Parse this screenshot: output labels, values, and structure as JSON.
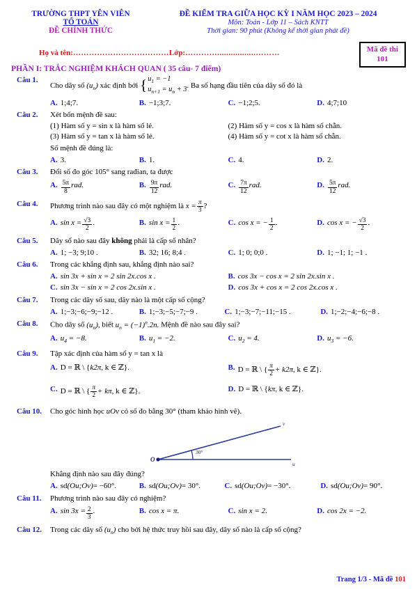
{
  "header": {
    "school": "TRƯỜNG THPT YÊN VIÊN",
    "department": "TỔ TOÁN",
    "official": "ĐỀ CHÍNH THỨC",
    "exam_title": "ĐỀ KIỂM TRA GIỮA HỌC KỲ I NĂM HỌC 2023 – 2024",
    "subject_line": "Môn: Toán - Lớp 11 – Sách KNTT",
    "time_line": "Thời gian: 90 phút (Không kể thời gian phát đề)",
    "code_label": "Mã đề thi",
    "code_value": "101",
    "name_label": "Họ và tên:",
    "name_dots": "………………………………",
    "class_label": "Lớp:",
    "class_dots": "………….................………"
  },
  "part_heading": "PHẦN I: TRẮC NGHIỆM KHÁCH QUAN ( 35 câu- 7 điểm)",
  "questions": {
    "q1": {
      "label": "Câu 1.",
      "stem_a": "Cho dãy số",
      "stem_b": "xác định bởi",
      "stem_c": ". Ba số hạng đầu tiên của dãy số đó là",
      "seq_symbol": "(u",
      "seq_sub": "n",
      "seq_close": ")",
      "sys_line1_left": "u",
      "sys_line1_sub": "1",
      "sys_line1_right": "= −1",
      "sys_line2_left": "u",
      "sys_line2_sub": "n+1",
      "sys_line2_right": "= u",
      "sys_line2_sub2": "n",
      "sys_line2_end": "+ 3",
      "answers": [
        {
          "letter": "A.",
          "text": "1;4;7."
        },
        {
          "letter": "B.",
          "text": "−1;3;7."
        },
        {
          "letter": "C.",
          "text": "−1;2;5."
        },
        {
          "letter": "D.",
          "text": "4;7;10"
        }
      ]
    },
    "q2": {
      "label": "Câu 2.",
      "stem": "Xét bốn mệnh đề sau:",
      "statements": [
        "(1) Hàm số  y = sin x  là hàm số lẻ.",
        "(2) Hàm số  y = cos x  là hàm số chẵn.",
        "(3) Hàm số  y = tan x  là hàm số lẻ.",
        "(4) Hàm số  y = cot x  là hàm số chẵn."
      ],
      "prompt": "Số mệnh đề đúng là:",
      "answers": [
        {
          "letter": "A.",
          "text": "3."
        },
        {
          "letter": "B.",
          "text": "1."
        },
        {
          "letter": "C.",
          "text": "4."
        },
        {
          "letter": "D.",
          "text": "2."
        }
      ]
    },
    "q3": {
      "label": "Câu 3.",
      "stem": "Đổi số đo góc 105° sang rađian, ta được",
      "answers": [
        {
          "letter": "A.",
          "num": "5π",
          "den": "8",
          "unit": "rad."
        },
        {
          "letter": "B.",
          "num": "9π",
          "den": "12",
          "unit": "rad."
        },
        {
          "letter": "C.",
          "num": "7π",
          "den": "12",
          "unit": "rad."
        },
        {
          "letter": "D.",
          "num": "5π",
          "den": "12",
          "unit": "rad."
        }
      ]
    },
    "q4": {
      "label": "Câu 4.",
      "stem_a": "Phương trình nào sau đây có một nghiệm là",
      "stem_x": "x =",
      "stem_num": "π",
      "stem_den": "3",
      "stem_q": "?",
      "answers": [
        {
          "letter": "A.",
          "lhs": "sin x =",
          "num": "√3",
          "den": "2",
          "tail": "."
        },
        {
          "letter": "B.",
          "lhs": "sin x =",
          "num": "1",
          "den": "2",
          "tail": "."
        },
        {
          "letter": "C.",
          "lhs": "cos x = −",
          "num": "1",
          "den": "2",
          "tail": "."
        },
        {
          "letter": "D.",
          "lhs": "cos x = −",
          "num": "√3",
          "den": "2",
          "tail": "."
        }
      ]
    },
    "q5": {
      "label": "Câu 5.",
      "stem_a": "Dãy số nào sau đây ",
      "stem_bold": "không",
      "stem_b": " phải là cấp số nhân?",
      "answers": [
        {
          "letter": "A.",
          "text": "1; −3; 9;10 ."
        },
        {
          "letter": "B.",
          "text": "32; 16; 8;4 ."
        },
        {
          "letter": "C.",
          "text": "1; 0; 0;0 ."
        },
        {
          "letter": "D.",
          "text": "1; −1; 1; −1 ."
        }
      ]
    },
    "q6": {
      "label": "Câu 6.",
      "stem": "Trong các khẳng định sau, khẳng định nào sai?",
      "answers": [
        {
          "letter": "A.",
          "text": "sin 3x + sin x = 2 sin 2x.cos x ."
        },
        {
          "letter": "B.",
          "text": "cos 3x − cos x = 2 sin 2x.sin x ."
        },
        {
          "letter": "C.",
          "text": "sin 3x − sin x = 2 cos 2x.sin x ."
        },
        {
          "letter": "D.",
          "text": "cos 3x + cos x = 2 cos 2x.cos x ."
        }
      ]
    },
    "q7": {
      "label": "Câu 7.",
      "stem": "Trong các dãy số sau, dãy nào là một cấp số cộng?",
      "answers": [
        {
          "letter": "A.",
          "text": "1;−3;−6;−9;−12 ."
        },
        {
          "letter": "B.",
          "text": "1;−3;−5;−7;−9 ."
        },
        {
          "letter": "C.",
          "text": "1;−3;−7;−11;−15 ."
        },
        {
          "letter": "D.",
          "text": "1;−2;−4;−6;−8 ."
        }
      ]
    },
    "q8": {
      "label": "Câu 8.",
      "stem_a": "Cho dãy số",
      "stem_seq": "(u",
      "stem_seq_sub": "n",
      "stem_seq_close": "),",
      "stem_b": "biết",
      "formula_lhs": "u",
      "formula_sub": "n",
      "formula_eq": "= (−1)",
      "formula_sup": "n",
      "formula_tail": ".2n.",
      "stem_c": "Mệnh đề nào sau đây sai?",
      "answers": [
        {
          "letter": "A.",
          "base": "u",
          "sub": "4",
          "text": "= −8."
        },
        {
          "letter": "B.",
          "base": "u",
          "sub": "1",
          "text": "= −2."
        },
        {
          "letter": "C.",
          "base": "u",
          "sub": "2",
          "text": "= 4."
        },
        {
          "letter": "D.",
          "base": "u",
          "sub": "3",
          "text": "= −6."
        }
      ]
    },
    "q9": {
      "label": "Câu 9.",
      "stem": "Tập xác định của hàm số  y = tan x  là",
      "answers": [
        {
          "letter": "A.",
          "prefix": "D = ℝ \\ {",
          "inner": "k2π",
          "suffix": ", k ∈ ℤ}.",
          "frac": false
        },
        {
          "letter": "B.",
          "prefix": "D = ℝ \\ {",
          "num": "π",
          "den": "2",
          "plus": "+ k2π",
          "suffix": ", k ∈ ℤ}.",
          "frac": true
        },
        {
          "letter": "C.",
          "prefix": "D = ℝ \\ {",
          "num": "π",
          "den": "2",
          "plus": "+ kπ",
          "suffix": ", k ∈ ℤ}.",
          "frac": true
        },
        {
          "letter": "D.",
          "prefix": "D = ℝ \\ {",
          "inner": "kπ",
          "suffix": ", k ∈ ℤ}.",
          "frac": false
        }
      ]
    },
    "q10": {
      "label": "Câu 10.",
      "stem_a": "Cho góc hình học",
      "stem_angle": "uOv",
      "stem_b": "có số đo bằng 30° (tham khảo hình vẽ).",
      "figure": {
        "vertex_label": "O",
        "ray_u_label": "u",
        "ray_v_label": "v",
        "angle_label": "30°"
      },
      "prompt": "Khẳng định nào sau đây đúng?",
      "answers": [
        {
          "letter": "A.",
          "pre": "sd",
          "arg": "(Ou;Ov)",
          "post": "= −60°."
        },
        {
          "letter": "B.",
          "pre": "sd",
          "arg": "(Ou;Ov)",
          "post": "= 30°."
        },
        {
          "letter": "C.",
          "pre": "sd",
          "arg": "(Ou;Ov)",
          "post": "= −30°."
        },
        {
          "letter": "D.",
          "pre": "sd",
          "arg": "(Ou;Ov)",
          "post": "= 90°."
        }
      ]
    },
    "q11": {
      "label": "Câu 11.",
      "stem": "Phương trình nào sau đây có nghiệm?",
      "answers": [
        {
          "letter": "A.",
          "lhs": "sin 3x =",
          "num": "2",
          "den": "3",
          "tail": ".",
          "frac": true
        },
        {
          "letter": "B.",
          "lhs": "cos x = π.",
          "frac": false
        },
        {
          "letter": "C.",
          "lhs": "sin x = 2.",
          "frac": false
        },
        {
          "letter": "D.",
          "lhs": "cos 2x = −2.",
          "frac": false
        }
      ]
    },
    "q12": {
      "label": "Câu 12.",
      "stem_a": "Trong các dãy số",
      "stem_seq": "(u",
      "stem_seq_sub": "n",
      "stem_seq_close": ")",
      "stem_b": "cho bởi hệ thức truy hồi sau đây, dãy số nào là cấp số cộng?"
    }
  },
  "footer": {
    "text": "Trang 1/3 - Mã đề ",
    "code": "101"
  },
  "colors": {
    "blue": "#1a1ad6",
    "magenta": "#b81fb8",
    "purple": "#a020c0",
    "red": "#d01c1c",
    "black": "#000000"
  }
}
